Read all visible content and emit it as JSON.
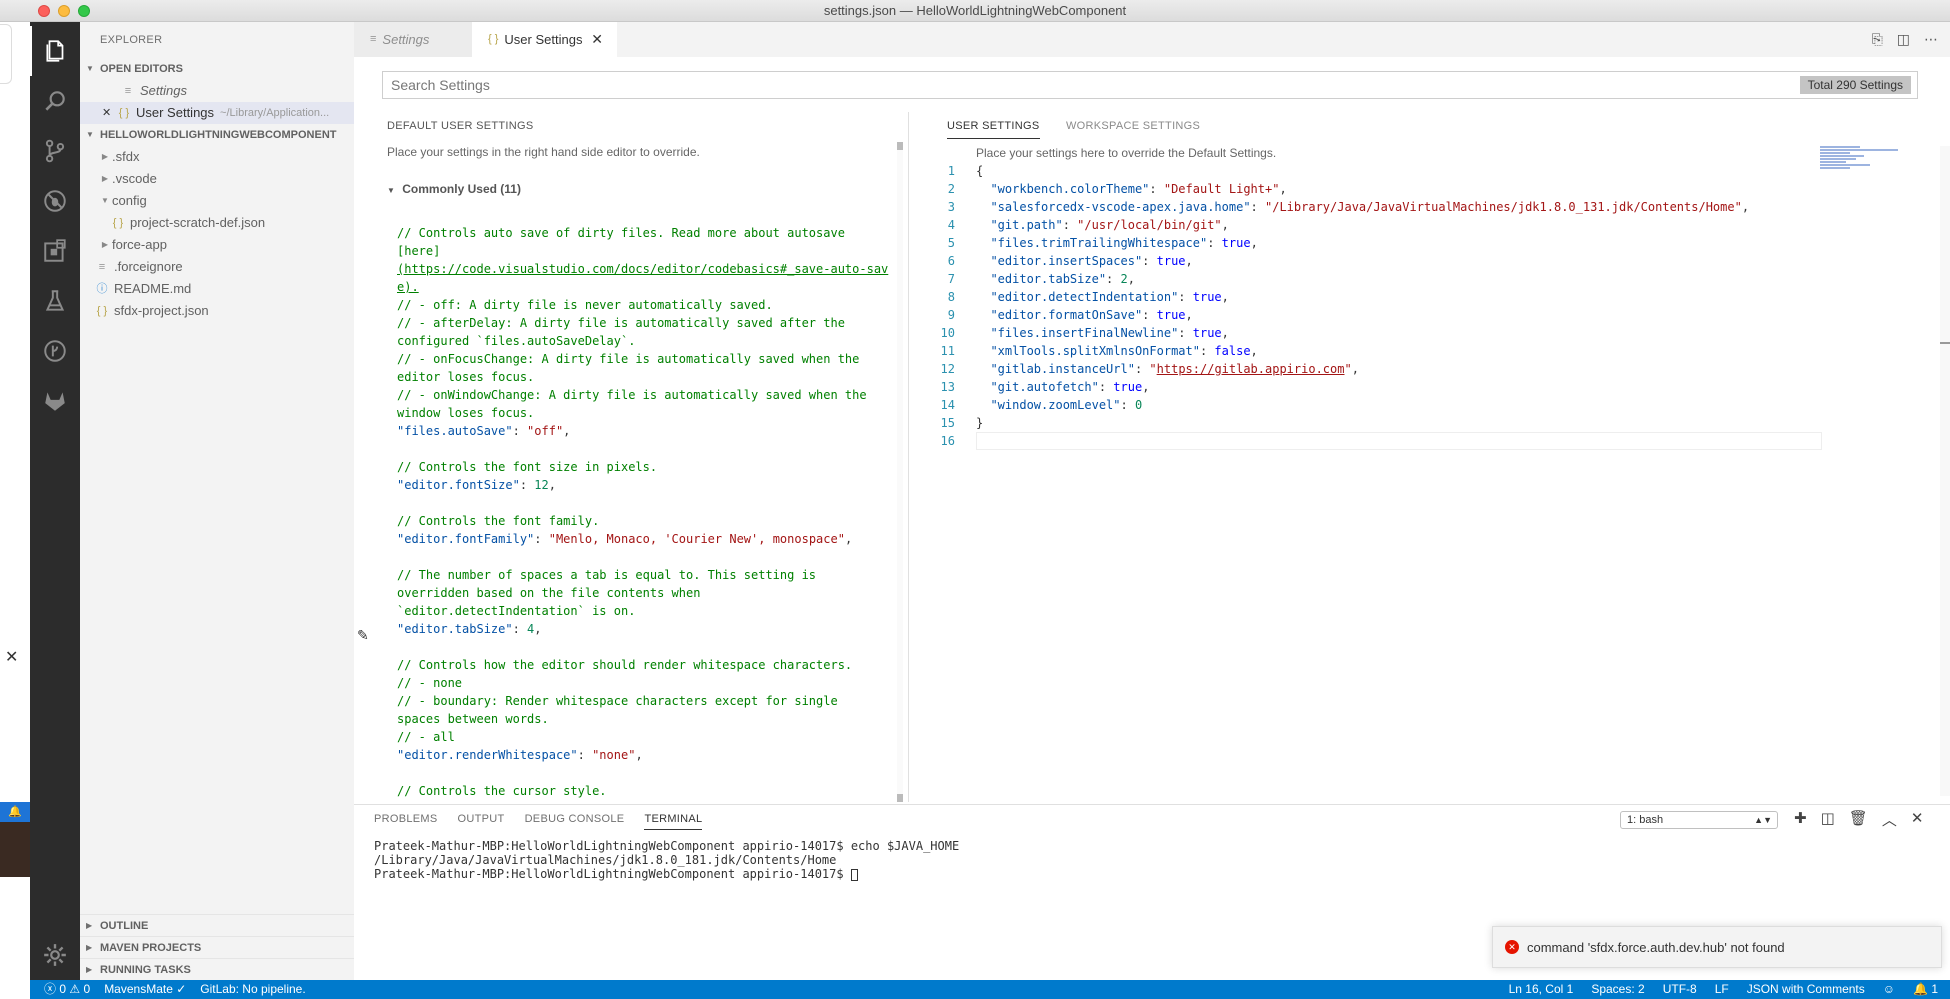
{
  "window": {
    "title": "settings.json — HelloWorldLightningWebComponent"
  },
  "sidebar": {
    "title": "EXPLORER",
    "open_editors_label": "OPEN EDITORS",
    "open_editors": [
      {
        "label": "Settings",
        "path": ""
      },
      {
        "label": "User Settings",
        "path": "~/Library/Application..."
      }
    ],
    "project_label": "HELLOWORLDLIGHTNINGWEBCOMPONENT",
    "tree": [
      {
        "label": ".sfdx",
        "type": "folder"
      },
      {
        "label": ".vscode",
        "type": "folder"
      },
      {
        "label": "config",
        "type": "folder-open"
      },
      {
        "label": "project-scratch-def.json",
        "type": "json"
      },
      {
        "label": "force-app",
        "type": "folder"
      },
      {
        "label": ".forceignore",
        "type": "text"
      },
      {
        "label": "README.md",
        "type": "info"
      },
      {
        "label": "sfdx-project.json",
        "type": "json"
      }
    ],
    "bottom_sections": [
      "OUTLINE",
      "MAVEN PROJECTS",
      "RUNNING TASKS"
    ]
  },
  "tabs": [
    {
      "label": "Settings"
    },
    {
      "label": "User Settings"
    }
  ],
  "search": {
    "placeholder": "Search Settings",
    "count": "Total 290 Settings"
  },
  "default_settings": {
    "heading": "DEFAULT USER SETTINGS",
    "description": "Place your settings in the right hand side editor to override.",
    "group": "Commonly Used (11)",
    "lines": [
      {
        "t": "com",
        "v": "// Controls auto save of dirty files. Read more about autosave"
      },
      {
        "t": "com",
        "v": "[here]"
      },
      {
        "t": "link",
        "v": "(https://code.visualstudio.com/docs/editor/codebasics#_save-auto-sav"
      },
      {
        "t": "link",
        "v": "e)."
      },
      {
        "t": "com",
        "v": "//  - off: A dirty file is never automatically saved."
      },
      {
        "t": "com",
        "v": "//  - afterDelay: A dirty file is automatically saved after the"
      },
      {
        "t": "com",
        "v": "configured `files.autoSaveDelay`."
      },
      {
        "t": "com",
        "v": "//  - onFocusChange: A dirty file is automatically saved when the"
      },
      {
        "t": "com",
        "v": "editor loses focus."
      },
      {
        "t": "com",
        "v": "//  - onWindowChange: A dirty file is automatically saved when the"
      },
      {
        "t": "com",
        "v": "window loses focus."
      },
      {
        "t": "kv",
        "k": "\"files.autoSave\"",
        "v": "\"off\"",
        "vt": "str"
      },
      {
        "t": "blank",
        "v": ""
      },
      {
        "t": "com",
        "v": "// Controls the font size in pixels."
      },
      {
        "t": "kv",
        "k": "\"editor.fontSize\"",
        "v": "12",
        "vt": "num"
      },
      {
        "t": "blank",
        "v": ""
      },
      {
        "t": "com",
        "v": "// Controls the font family."
      },
      {
        "t": "kv",
        "k": "\"editor.fontFamily\"",
        "v": "\"Menlo, Monaco, 'Courier New', monospace\"",
        "vt": "str"
      },
      {
        "t": "blank",
        "v": ""
      },
      {
        "t": "com",
        "v": "// The number of spaces a tab is equal to. This setting is"
      },
      {
        "t": "com",
        "v": "overridden based on the file contents when"
      },
      {
        "t": "com",
        "v": "`editor.detectIndentation` is on."
      },
      {
        "t": "kv",
        "k": "\"editor.tabSize\"",
        "v": "4",
        "vt": "num"
      },
      {
        "t": "blank",
        "v": ""
      },
      {
        "t": "com",
        "v": "// Controls how the editor should render whitespace characters."
      },
      {
        "t": "com",
        "v": "//  - none"
      },
      {
        "t": "com",
        "v": "//  - boundary: Render whitespace characters except for single"
      },
      {
        "t": "com",
        "v": "spaces between words."
      },
      {
        "t": "com",
        "v": "//  - all"
      },
      {
        "t": "kv",
        "k": "\"editor.renderWhitespace\"",
        "v": "\"none\"",
        "vt": "str"
      },
      {
        "t": "blank",
        "v": ""
      },
      {
        "t": "com",
        "v": "// Controls the cursor style."
      }
    ]
  },
  "user_settings": {
    "tab_user": "USER SETTINGS",
    "tab_workspace": "WORKSPACE SETTINGS",
    "description": "Place your settings here to override the Default Settings.",
    "lines": [
      {
        "n": "1",
        "t": "brace",
        "v": "{"
      },
      {
        "n": "2",
        "t": "kv",
        "k": "\"workbench.colorTheme\"",
        "v": "\"Default Light+\"",
        "vt": "str",
        "c": ","
      },
      {
        "n": "3",
        "t": "kv",
        "k": "\"salesforcedx-vscode-apex.java.home\"",
        "v": "\"/Library/Java/JavaVirtualMachines/jdk1.8.0_131.jdk/Contents/Home\"",
        "vt": "str",
        "c": ","
      },
      {
        "n": "4",
        "t": "kv",
        "k": "\"git.path\"",
        "v": "\"/usr/local/bin/git\"",
        "vt": "str",
        "c": ","
      },
      {
        "n": "5",
        "t": "kv",
        "k": "\"files.trimTrailingWhitespace\"",
        "v": "true",
        "vt": "kw",
        "c": ","
      },
      {
        "n": "6",
        "t": "kv",
        "k": "\"editor.insertSpaces\"",
        "v": "true",
        "vt": "kw",
        "c": ","
      },
      {
        "n": "7",
        "t": "kv",
        "k": "\"editor.tabSize\"",
        "v": "2",
        "vt": "num",
        "c": ","
      },
      {
        "n": "8",
        "t": "kv",
        "k": "\"editor.detectIndentation\"",
        "v": "true",
        "vt": "kw",
        "c": ","
      },
      {
        "n": "9",
        "t": "kv",
        "k": "\"editor.formatOnSave\"",
        "v": "true",
        "vt": "kw",
        "c": ","
      },
      {
        "n": "10",
        "t": "kv",
        "k": "\"files.insertFinalNewline\"",
        "v": "true",
        "vt": "kw",
        "c": ","
      },
      {
        "n": "11",
        "t": "kv",
        "k": "\"xmlTools.splitXmlnsOnFormat\"",
        "v": "false",
        "vt": "kw",
        "c": ","
      },
      {
        "n": "12",
        "t": "kvlink",
        "k": "\"gitlab.instanceUrl\"",
        "v": "https://gitlab.appirio.com",
        "vt": "str",
        "c": ","
      },
      {
        "n": "13",
        "t": "kv",
        "k": "\"git.autofetch\"",
        "v": "true",
        "vt": "kw",
        "c": ","
      },
      {
        "n": "14",
        "t": "kv",
        "k": "\"window.zoomLevel\"",
        "v": "0",
        "vt": "num",
        "c": ""
      },
      {
        "n": "15",
        "t": "brace",
        "v": "}"
      },
      {
        "n": "16",
        "t": "blank",
        "v": ""
      }
    ]
  },
  "panel": {
    "tabs": [
      "PROBLEMS",
      "OUTPUT",
      "DEBUG CONSOLE",
      "TERMINAL"
    ],
    "active_tab": "TERMINAL",
    "terminal_select": "1: bash",
    "terminal_lines": [
      "Prateek-Mathur-MBP:HelloWorldLightningWebComponent appirio-14017$ echo $JAVA_HOME",
      "/Library/Java/JavaVirtualMachines/jdk1.8.0_181.jdk/Contents/Home",
      "Prateek-Mathur-MBP:HelloWorldLightningWebComponent appirio-14017$ "
    ]
  },
  "notification": {
    "message": "command 'sfdx.force.auth.dev.hub' not found"
  },
  "status_bar": {
    "errors": "0",
    "warnings": "0",
    "mavensmate": "MavensMate ✓",
    "gitlab": "GitLab: No pipeline.",
    "position": "Ln 16, Col 1",
    "spaces": "Spaces: 2",
    "encoding": "UTF-8",
    "eol": "LF",
    "language": "JSON with Comments",
    "notifications": "1"
  }
}
